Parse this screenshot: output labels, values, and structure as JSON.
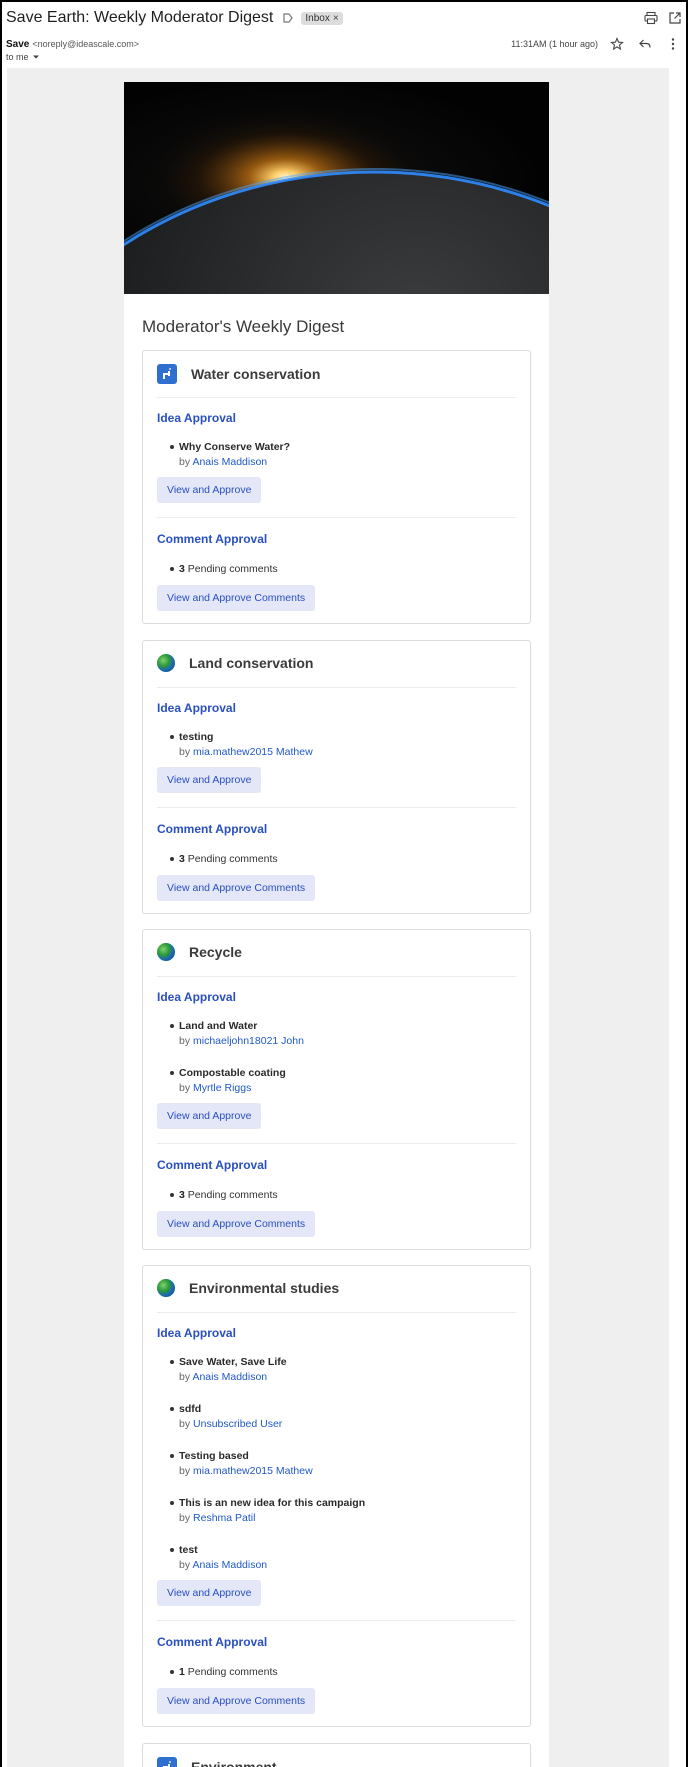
{
  "header": {
    "subject": "Save Earth: Weekly Moderator Digest",
    "inbox_label": "Inbox",
    "sender_name": "Save",
    "sender_email": "<noreply@ideascale.com>",
    "to": "to me",
    "timestamp": "11:31AM (1 hour ago)"
  },
  "digest": {
    "title": "Moderator's Weekly Digest",
    "idea_approval_label": "Idea Approval",
    "comment_approval_label": "Comment Approval",
    "view_button": "View and Approve",
    "view_comments_button": "View and Approve Comments",
    "pending_suffix": "Pending comments",
    "by_prefix": "by",
    "sections": [
      {
        "title": "Water conservation",
        "icon": "tap-icon",
        "ideas": [
          {
            "name": "Why Conserve Water?",
            "author": "Anais Maddison"
          }
        ],
        "pending_count": "3"
      },
      {
        "title": "Land conservation",
        "icon": "globe-icon",
        "ideas": [
          {
            "name": "testing",
            "author": "mia.mathew2015 Mathew"
          }
        ],
        "pending_count": "3"
      },
      {
        "title": "Recycle",
        "icon": "globe-icon",
        "ideas": [
          {
            "name": "Land and Water",
            "author": "michaeljohn18021 John"
          },
          {
            "name": "Compostable coating",
            "author": "Myrtle Riggs"
          }
        ],
        "pending_count": "3"
      },
      {
        "title": "Environmental studies",
        "icon": "globe-icon",
        "ideas": [
          {
            "name": "Save Water, Save Life",
            "author": "Anais Maddison"
          },
          {
            "name": "sdfd",
            "author": "Unsubscribed User"
          },
          {
            "name": "Testing based",
            "author": "mia.mathew2015 Mathew"
          },
          {
            "name": "This is an new idea for this campaign",
            "author": "Reshma Patil"
          },
          {
            "name": "test",
            "author": "Anais Maddison"
          }
        ],
        "pending_count": "1"
      },
      {
        "title": "Environment",
        "icon": "tap-icon"
      }
    ]
  }
}
